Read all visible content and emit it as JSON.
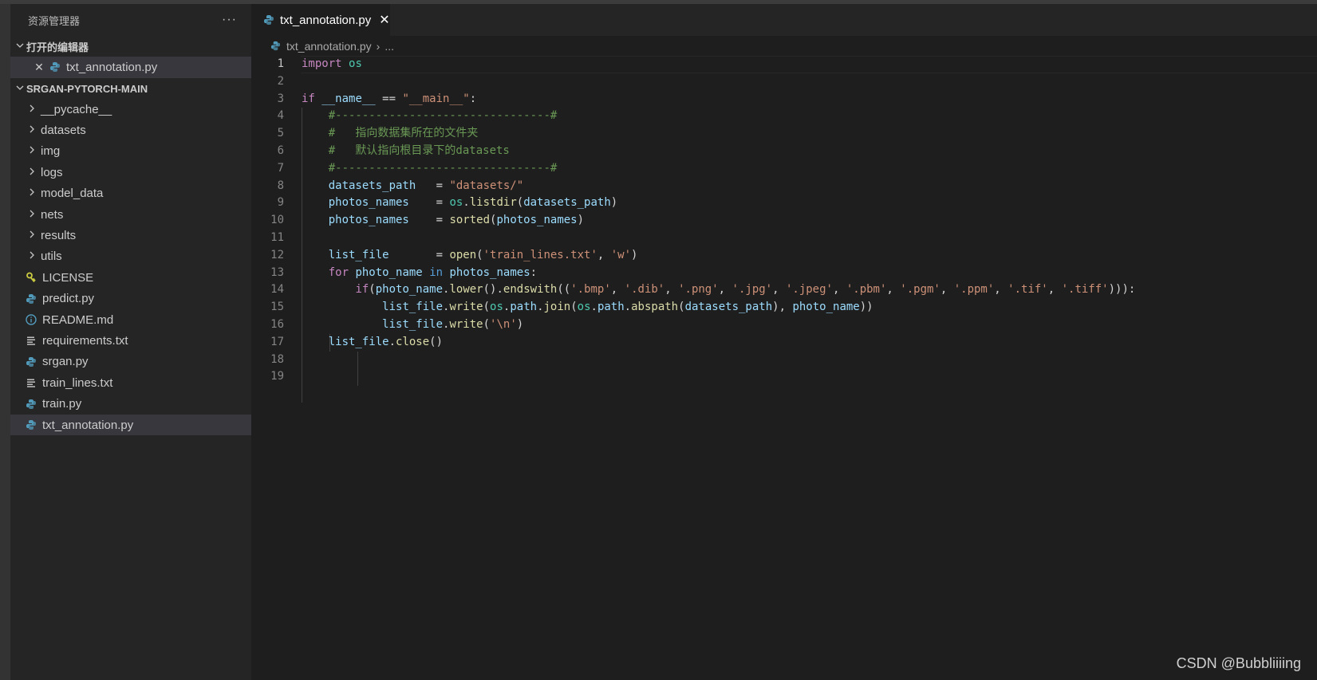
{
  "colors": {
    "background": "#1e1e1e",
    "sidebar": "#252526",
    "selection": "#37373d",
    "python_icon": "#519aba",
    "license_icon": "#cbcb41",
    "info_icon": "#519aba"
  },
  "sidebar": {
    "title": "资源管理器",
    "more": "···",
    "open_editors": {
      "label": "打开的编辑器",
      "items": [
        {
          "close": "✕",
          "icon": "python-icon",
          "name": "txt_annotation.py"
        }
      ]
    },
    "project": {
      "label": "SRGAN-PYTORCH-MAIN",
      "folders": [
        "__pycache__",
        "datasets",
        "img",
        "logs",
        "model_data",
        "nets",
        "results",
        "utils"
      ],
      "files": [
        {
          "icon": "license-icon",
          "name": "LICENSE"
        },
        {
          "icon": "python-icon",
          "name": "predict.py"
        },
        {
          "icon": "info-icon",
          "name": "README.md"
        },
        {
          "icon": "text-file-icon",
          "name": "requirements.txt"
        },
        {
          "icon": "python-icon",
          "name": "srgan.py"
        },
        {
          "icon": "text-file-icon",
          "name": "train_lines.txt"
        },
        {
          "icon": "python-icon",
          "name": "train.py"
        },
        {
          "icon": "python-icon",
          "name": "txt_annotation.py"
        }
      ],
      "selected_file": "txt_annotation.py"
    }
  },
  "tabs": [
    {
      "label": "txt_annotation.py",
      "icon": "python-icon",
      "close": "✕"
    }
  ],
  "breadcrumb": {
    "file": "txt_annotation.py",
    "separator": "›",
    "rest": "..."
  },
  "editor": {
    "active_line": 1,
    "lines": [
      [
        {
          "t": "import",
          "c": "kw"
        },
        {
          "t": " "
        },
        {
          "t": "os",
          "c": "mod"
        }
      ],
      [],
      [
        {
          "t": "if",
          "c": "kw"
        },
        {
          "t": " "
        },
        {
          "t": "__name__",
          "c": "var"
        },
        {
          "t": " == ",
          "c": "op"
        },
        {
          "t": "\"__main__\"",
          "c": "str"
        },
        {
          "t": ":",
          "c": "op"
        }
      ],
      [
        {
          "t": "    "
        },
        {
          "t": "#--------------------------------#",
          "c": "cm"
        }
      ],
      [
        {
          "t": "    "
        },
        {
          "t": "#   指向数据集所在的文件夹",
          "c": "cm"
        }
      ],
      [
        {
          "t": "    "
        },
        {
          "t": "#   默认指向根目录下的datasets",
          "c": "cm"
        }
      ],
      [
        {
          "t": "    "
        },
        {
          "t": "#--------------------------------#",
          "c": "cm"
        }
      ],
      [
        {
          "t": "    "
        },
        {
          "t": "datasets_path",
          "c": "var"
        },
        {
          "t": "   = ",
          "c": "op"
        },
        {
          "t": "\"datasets/\"",
          "c": "str"
        }
      ],
      [
        {
          "t": "    "
        },
        {
          "t": "photos_names",
          "c": "var"
        },
        {
          "t": "    = ",
          "c": "op"
        },
        {
          "t": "os",
          "c": "mod"
        },
        {
          "t": ".",
          "c": "op"
        },
        {
          "t": "listdir",
          "c": "fn"
        },
        {
          "t": "(",
          "c": "op"
        },
        {
          "t": "datasets_path",
          "c": "var"
        },
        {
          "t": ")",
          "c": "op"
        }
      ],
      [
        {
          "t": "    "
        },
        {
          "t": "photos_names",
          "c": "var"
        },
        {
          "t": "    = ",
          "c": "op"
        },
        {
          "t": "sorted",
          "c": "fn"
        },
        {
          "t": "(",
          "c": "op"
        },
        {
          "t": "photos_names",
          "c": "var"
        },
        {
          "t": ")",
          "c": "op"
        }
      ],
      [],
      [
        {
          "t": "    "
        },
        {
          "t": "list_file",
          "c": "var"
        },
        {
          "t": "       = ",
          "c": "op"
        },
        {
          "t": "open",
          "c": "fn"
        },
        {
          "t": "(",
          "c": "op"
        },
        {
          "t": "'train_lines.txt'",
          "c": "str"
        },
        {
          "t": ", ",
          "c": "op"
        },
        {
          "t": "'w'",
          "c": "str"
        },
        {
          "t": ")",
          "c": "op"
        }
      ],
      [
        {
          "t": "    "
        },
        {
          "t": "for",
          "c": "kw"
        },
        {
          "t": " "
        },
        {
          "t": "photo_name",
          "c": "var"
        },
        {
          "t": " "
        },
        {
          "t": "in",
          "c": "kb"
        },
        {
          "t": " "
        },
        {
          "t": "photos_names",
          "c": "var"
        },
        {
          "t": ":",
          "c": "op"
        }
      ],
      [
        {
          "t": "        "
        },
        {
          "t": "if",
          "c": "kw"
        },
        {
          "t": "(",
          "c": "op"
        },
        {
          "t": "photo_name",
          "c": "var"
        },
        {
          "t": ".",
          "c": "op"
        },
        {
          "t": "lower",
          "c": "fn"
        },
        {
          "t": "().",
          "c": "op"
        },
        {
          "t": "endswith",
          "c": "fn"
        },
        {
          "t": "((",
          "c": "op"
        },
        {
          "t": "'.bmp'",
          "c": "str"
        },
        {
          "t": ", ",
          "c": "op"
        },
        {
          "t": "'.dib'",
          "c": "str"
        },
        {
          "t": ", ",
          "c": "op"
        },
        {
          "t": "'.png'",
          "c": "str"
        },
        {
          "t": ", ",
          "c": "op"
        },
        {
          "t": "'.jpg'",
          "c": "str"
        },
        {
          "t": ", ",
          "c": "op"
        },
        {
          "t": "'.jpeg'",
          "c": "str"
        },
        {
          "t": ", ",
          "c": "op"
        },
        {
          "t": "'.pbm'",
          "c": "str"
        },
        {
          "t": ", ",
          "c": "op"
        },
        {
          "t": "'.pgm'",
          "c": "str"
        },
        {
          "t": ", ",
          "c": "op"
        },
        {
          "t": "'.ppm'",
          "c": "str"
        },
        {
          "t": ", ",
          "c": "op"
        },
        {
          "t": "'.tif'",
          "c": "str"
        },
        {
          "t": ", ",
          "c": "op"
        },
        {
          "t": "'.tiff'",
          "c": "str"
        },
        {
          "t": "))):",
          "c": "op"
        }
      ],
      [
        {
          "t": "            "
        },
        {
          "t": "list_file",
          "c": "var"
        },
        {
          "t": ".",
          "c": "op"
        },
        {
          "t": "write",
          "c": "fn"
        },
        {
          "t": "(",
          "c": "op"
        },
        {
          "t": "os",
          "c": "mod"
        },
        {
          "t": ".",
          "c": "op"
        },
        {
          "t": "path",
          "c": "var"
        },
        {
          "t": ".",
          "c": "op"
        },
        {
          "t": "join",
          "c": "fn"
        },
        {
          "t": "(",
          "c": "op"
        },
        {
          "t": "os",
          "c": "mod"
        },
        {
          "t": ".",
          "c": "op"
        },
        {
          "t": "path",
          "c": "var"
        },
        {
          "t": ".",
          "c": "op"
        },
        {
          "t": "abspath",
          "c": "fn"
        },
        {
          "t": "(",
          "c": "op"
        },
        {
          "t": "datasets_path",
          "c": "var"
        },
        {
          "t": "), ",
          "c": "op"
        },
        {
          "t": "photo_name",
          "c": "var"
        },
        {
          "t": "))",
          "c": "op"
        }
      ],
      [
        {
          "t": "            "
        },
        {
          "t": "list_file",
          "c": "var"
        },
        {
          "t": ".",
          "c": "op"
        },
        {
          "t": "write",
          "c": "fn"
        },
        {
          "t": "(",
          "c": "op"
        },
        {
          "t": "'\\n'",
          "c": "str"
        },
        {
          "t": ")",
          "c": "op"
        }
      ],
      [
        {
          "t": "    "
        },
        {
          "t": "list_file",
          "c": "var"
        },
        {
          "t": ".",
          "c": "op"
        },
        {
          "t": "close",
          "c": "fn"
        },
        {
          "t": "()",
          "c": "op"
        }
      ],
      [],
      []
    ]
  },
  "watermark": "CSDN @Bubbliiiing"
}
